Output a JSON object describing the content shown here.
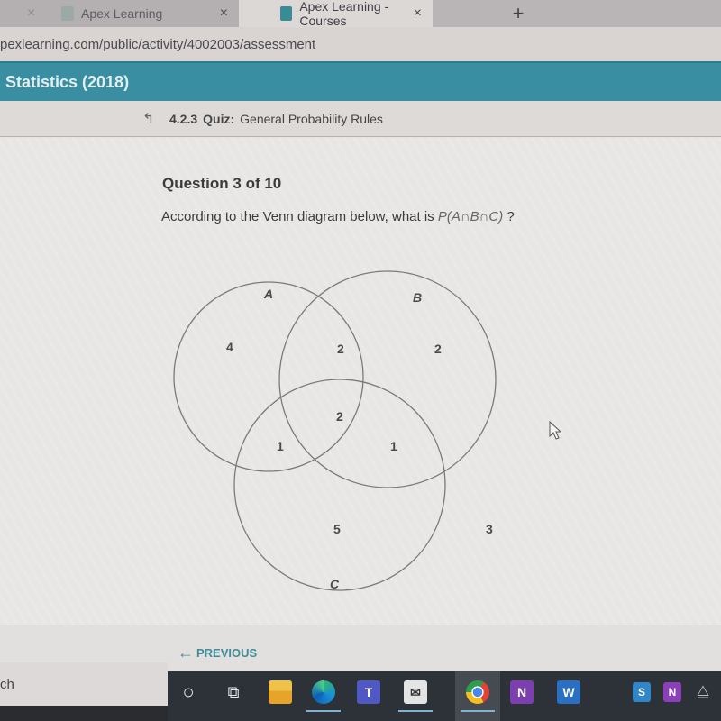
{
  "browser": {
    "tabs": [
      {
        "label": "Apex Learning",
        "active": false
      },
      {
        "label": "Apex Learning - Courses",
        "active": true
      }
    ],
    "new_tab_label": "+",
    "close_glyph": "×",
    "url": "pexlearning.com/public/activity/4002003/assessment"
  },
  "course": {
    "title": "Statistics (2018)"
  },
  "breadcrumb": {
    "up_icon": "↰",
    "number": "4.2.3",
    "type": "Quiz:",
    "title": "General Probability Rules"
  },
  "question": {
    "number_label": "Question 3 of 10",
    "prompt": "According to the Venn diagram below, what is ",
    "expression": "P(A∩B∩C)",
    "suffix": " ?"
  },
  "venn": {
    "set_labels": {
      "A": "A",
      "B": "B",
      "C": "C"
    },
    "regions": {
      "A_only": "4",
      "A_and_B_only": "2",
      "B_only": "2",
      "A_and_B_and_C": "2",
      "A_and_C_only": "1",
      "B_and_C_only": "1",
      "C_only": "5",
      "outside": "3"
    }
  },
  "navigation": {
    "previous_arrow": "←",
    "previous_label": "PREVIOUS"
  },
  "taskbar": {
    "search_text": "ch",
    "icons": [
      {
        "name": "cortana",
        "glyph": "○"
      },
      {
        "name": "task-view",
        "glyph": "⧉"
      },
      {
        "name": "file-explorer",
        "glyph": ""
      },
      {
        "name": "edge",
        "glyph": ""
      },
      {
        "name": "teams",
        "glyph": "T"
      },
      {
        "name": "mail",
        "glyph": "✉"
      },
      {
        "name": "chrome",
        "glyph": ""
      },
      {
        "name": "onenote",
        "glyph": "N"
      },
      {
        "name": "word",
        "glyph": "W"
      },
      {
        "name": "security",
        "glyph": "S"
      },
      {
        "name": "onenote-tray",
        "glyph": "N"
      },
      {
        "name": "network",
        "glyph": "⧋"
      }
    ]
  },
  "colors": {
    "header": "#3a8ea2",
    "accent": "#3f8d97",
    "taskbar": "#2c3238"
  }
}
